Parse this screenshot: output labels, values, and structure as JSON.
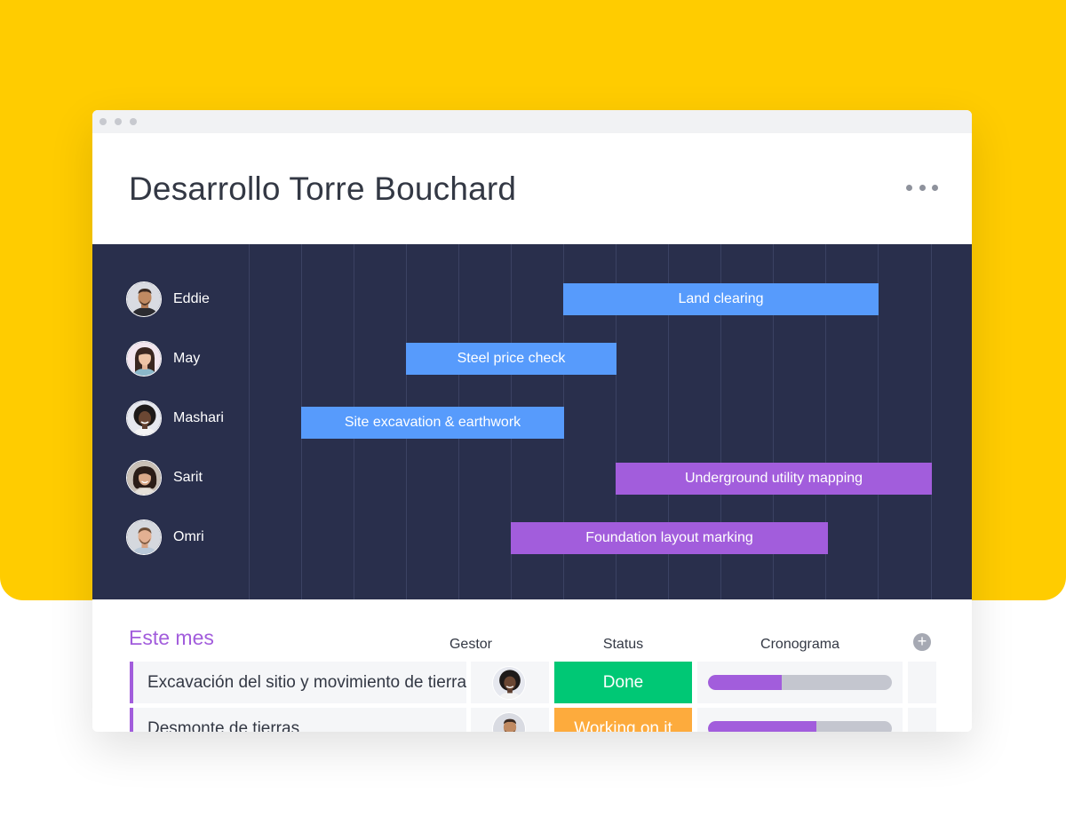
{
  "board": {
    "title": "Desarrollo Torre Bouchard"
  },
  "colors": {
    "background_accent": "#ffcc00",
    "gantt_background": "#292f4c",
    "bar_blue": "#579bfc",
    "bar_purple": "#a25ddc",
    "status_done": "#00c875",
    "status_working": "#fdab3d"
  },
  "gantt": {
    "people": [
      {
        "name": "Eddie",
        "avatar_icon": "avatar-eddie"
      },
      {
        "name": "May",
        "avatar_icon": "avatar-may"
      },
      {
        "name": "Mashari",
        "avatar_icon": "avatar-mashari"
      },
      {
        "name": "Sarit",
        "avatar_icon": "avatar-sarit"
      },
      {
        "name": "Omri",
        "avatar_icon": "avatar-omri"
      }
    ],
    "bars": [
      {
        "label": "Land clearing",
        "color": "blue"
      },
      {
        "label": "Steel price check",
        "color": "blue"
      },
      {
        "label": "Site excavation & earthwork",
        "color": "blue"
      },
      {
        "label": "Underground utility mapping",
        "color": "purple"
      },
      {
        "label": "Foundation layout marking",
        "color": "purple"
      }
    ]
  },
  "table": {
    "group_title": "Este mes",
    "columns": {
      "owner": "Gestor",
      "status": "Status",
      "timeline": "Cronograma"
    },
    "add_column_icon": "plus-circle-icon",
    "rows": [
      {
        "name": "Excavación del sitio y movimiento de tierra",
        "status": "Done",
        "status_color": "#00c875",
        "timeline_progress": 0.4
      },
      {
        "name": "Desmonte de tierras",
        "status": "Working on it",
        "status_color": "#fdab3d",
        "timeline_progress": 0.59
      }
    ]
  }
}
